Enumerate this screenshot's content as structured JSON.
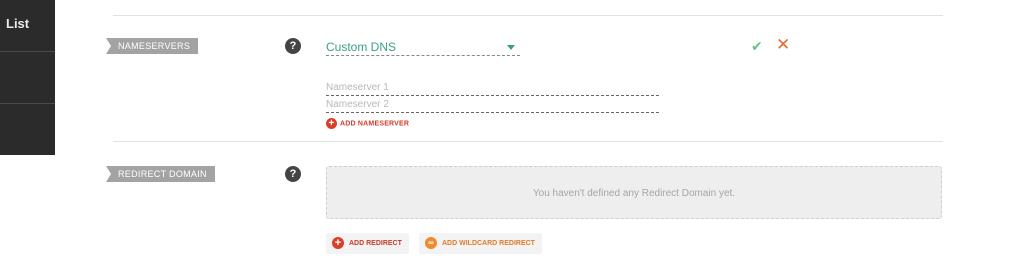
{
  "sidebar": {
    "items": [
      {
        "label": "List"
      },
      {
        "label": ""
      },
      {
        "label": ""
      }
    ]
  },
  "nameservers": {
    "tag": "NAMESERVERS",
    "help": "?",
    "select_value": "Custom DNS",
    "fields": [
      {
        "placeholder": "Nameserver 1"
      },
      {
        "placeholder": "Nameserver 2"
      }
    ],
    "add_label": "ADD NAMESERVER",
    "confirm_icon": "check-icon",
    "cancel_icon": "close-icon"
  },
  "redirect": {
    "tag": "REDIRECT DOMAIN",
    "help": "?",
    "empty_message": "You haven't defined any Redirect Domain yet.",
    "add_label": "ADD REDIRECT",
    "add_wildcard_label": "ADD WILDCARD REDIRECT"
  },
  "colors": {
    "accent_green": "#3a9e87",
    "confirm": "#6ac08e",
    "cancel": "#e46a2e",
    "add_red": "#d9402b",
    "add_orange": "#ef8a2d",
    "sidebar": "#2b2b2b"
  }
}
